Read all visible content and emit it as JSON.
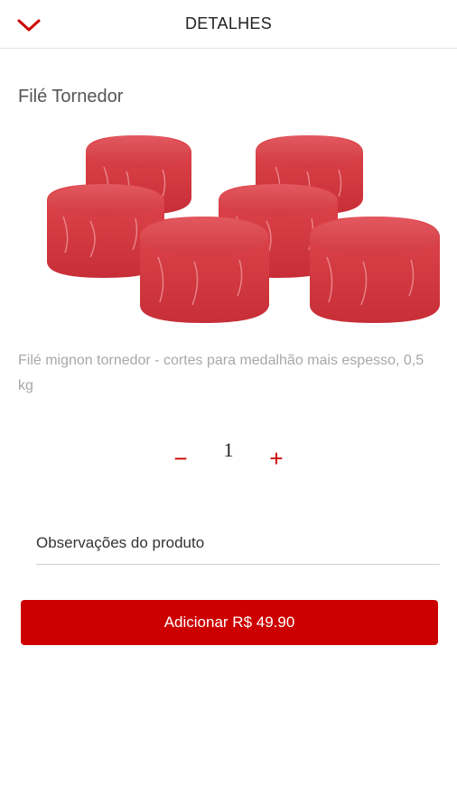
{
  "header": {
    "title": "DETALHES",
    "back_icon": "chevron-down-icon"
  },
  "product": {
    "name": "Filé Tornedor",
    "description": "Filé mignon tornedor - cortes para medalhão mais espesso, 0,5 kg",
    "image_subject": "filet-mignon-medallions"
  },
  "quantity": {
    "value": "1",
    "minus_label": "−",
    "plus_label": "+"
  },
  "observations": {
    "placeholder": "Observações do produto",
    "value": ""
  },
  "add_button": {
    "label": "Adicionar R$ 49.90"
  },
  "colors": {
    "accent": "#cc0000",
    "meat": "#d9363e"
  }
}
